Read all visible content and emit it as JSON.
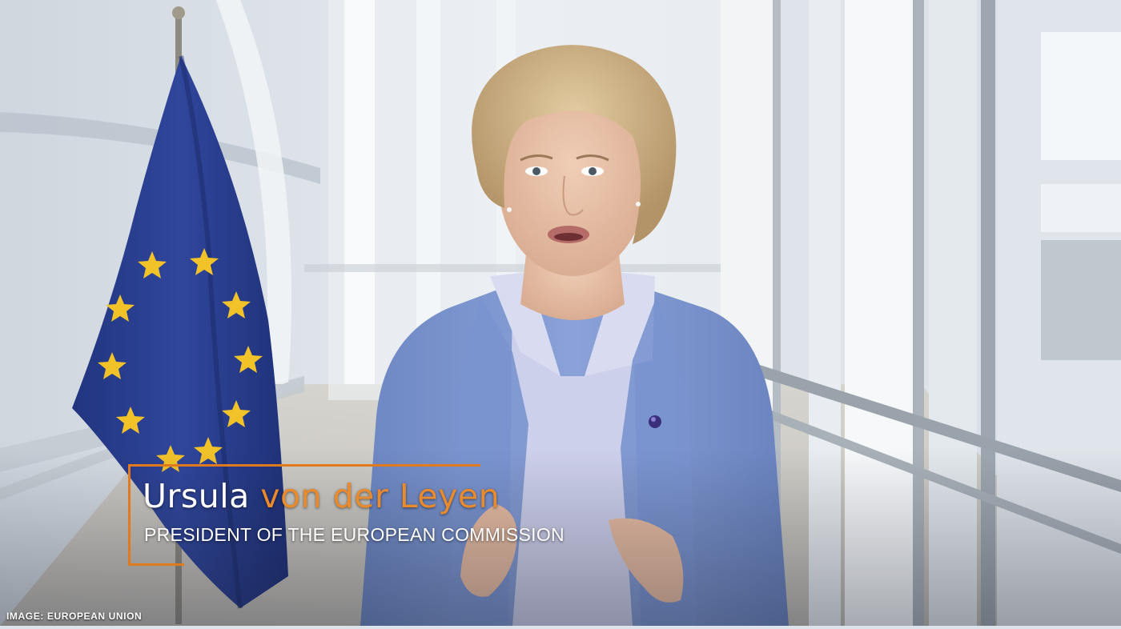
{
  "caption": {
    "first_name": "Ursula",
    "last_name": "von der Leyen",
    "role": "PRESIDENT OF THE EUROPEAN COMMISSION"
  },
  "credit": "IMAGE: EUROPEAN UNION",
  "colors": {
    "accent_orange": "#e07a1f",
    "flag_blue": "#2a3e93",
    "flag_star": "#f2c229",
    "jacket_blue": "#7f9ad3"
  }
}
